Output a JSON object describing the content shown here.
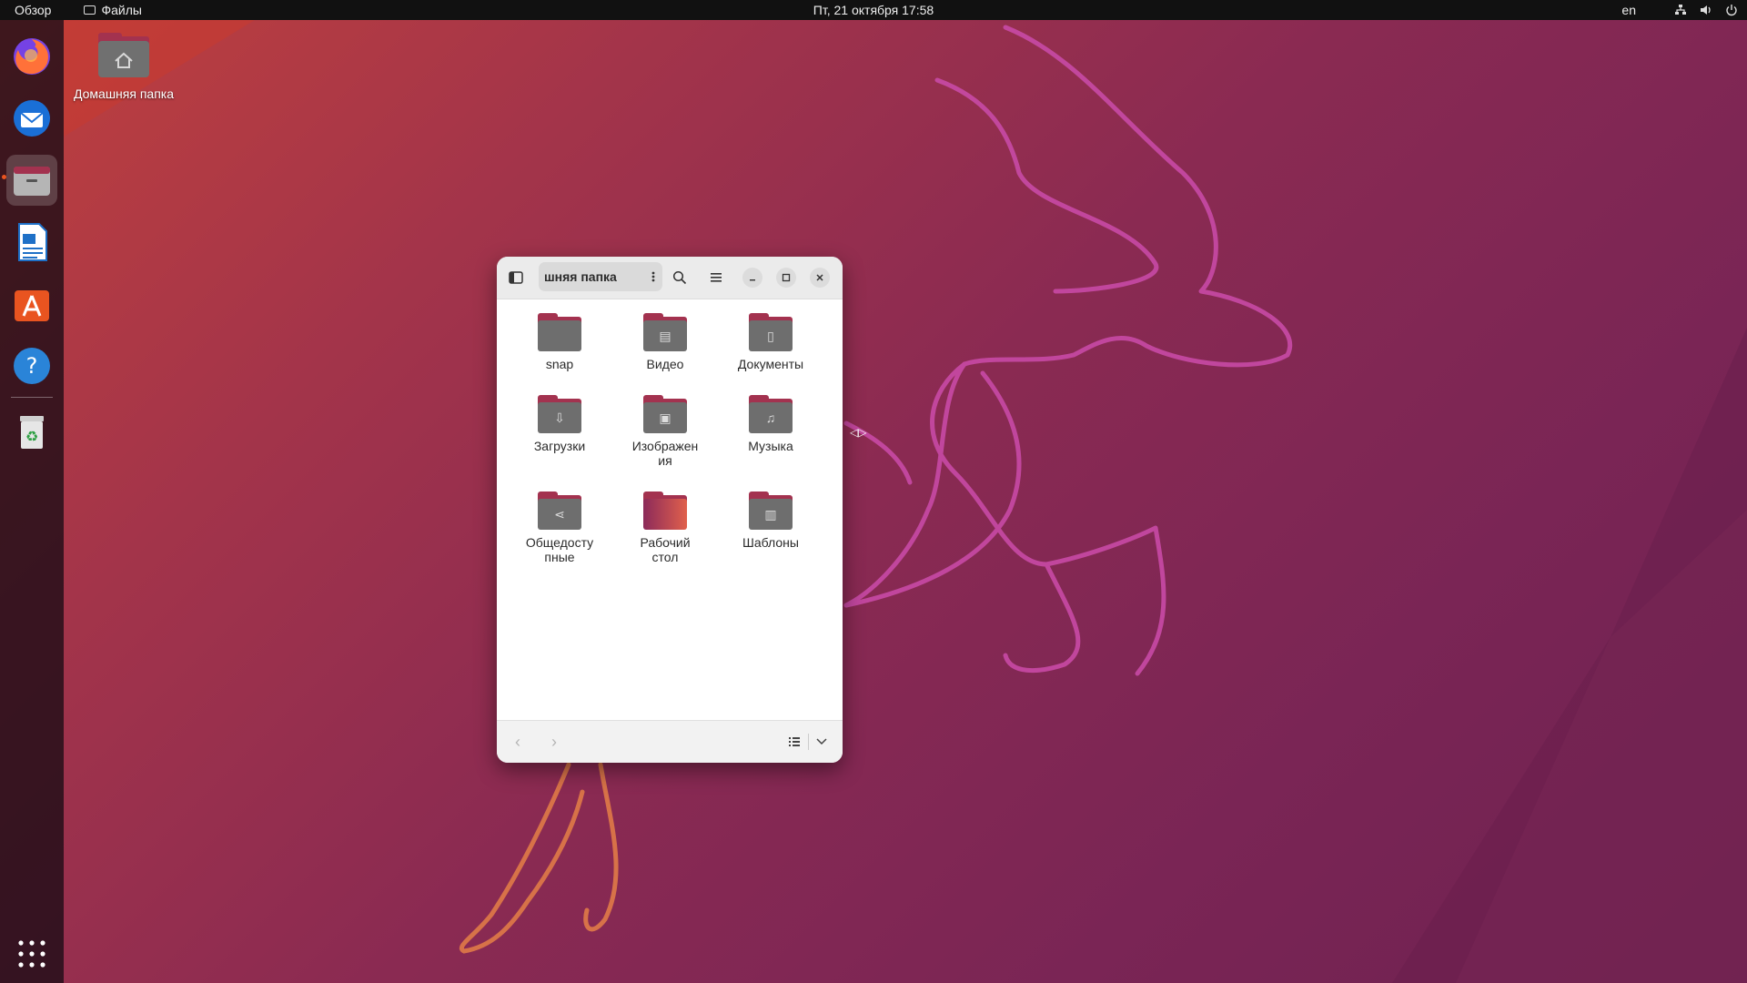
{
  "topbar": {
    "activities": "Обзор",
    "app_name": "Файлы",
    "datetime": "Пт, 21 октября  17:58",
    "keyboard_layout": "en",
    "tray_icons": [
      "network-icon",
      "volume-icon",
      "power-icon"
    ]
  },
  "dock": {
    "items": [
      {
        "name": "firefox",
        "icon": "firefox-icon"
      },
      {
        "name": "thunderbird",
        "icon": "thunderbird-icon"
      },
      {
        "name": "files",
        "icon": "files-icon",
        "active": true
      },
      {
        "name": "libreoffice-writer",
        "icon": "writer-icon"
      },
      {
        "name": "ubuntu-software",
        "icon": "software-icon"
      },
      {
        "name": "help",
        "icon": "help-icon"
      },
      {
        "name": "trash",
        "icon": "trash-icon"
      }
    ],
    "show_apps_icon": "app-grid-icon"
  },
  "desktop": {
    "home_label": "Домашняя папка"
  },
  "window": {
    "path_label": "шняя папка",
    "items": [
      {
        "label": "snap",
        "icon": "folder-icon"
      },
      {
        "label": "Видео",
        "icon": "video-folder-icon"
      },
      {
        "label": "Документы",
        "icon": "documents-folder-icon"
      },
      {
        "label": "Загрузки",
        "icon": "downloads-folder-icon"
      },
      {
        "label": "Изображения",
        "label_lines": [
          "Изображен",
          "ия"
        ],
        "icon": "pictures-folder-icon"
      },
      {
        "label": "Музыка",
        "icon": "music-folder-icon"
      },
      {
        "label": "Общедоступные",
        "label_lines": [
          "Общедосту",
          "пные"
        ],
        "icon": "public-folder-icon"
      },
      {
        "label": "Рабочий стол",
        "label_lines": [
          "Рабочий",
          "стол"
        ],
        "icon": "desktop-folder-icon"
      },
      {
        "label": "Шаблоны",
        "icon": "templates-folder-icon"
      }
    ]
  },
  "colors": {
    "accent": "#e95420",
    "folder_tab": "#a3324f",
    "folder_body": "#6e6e6e"
  }
}
